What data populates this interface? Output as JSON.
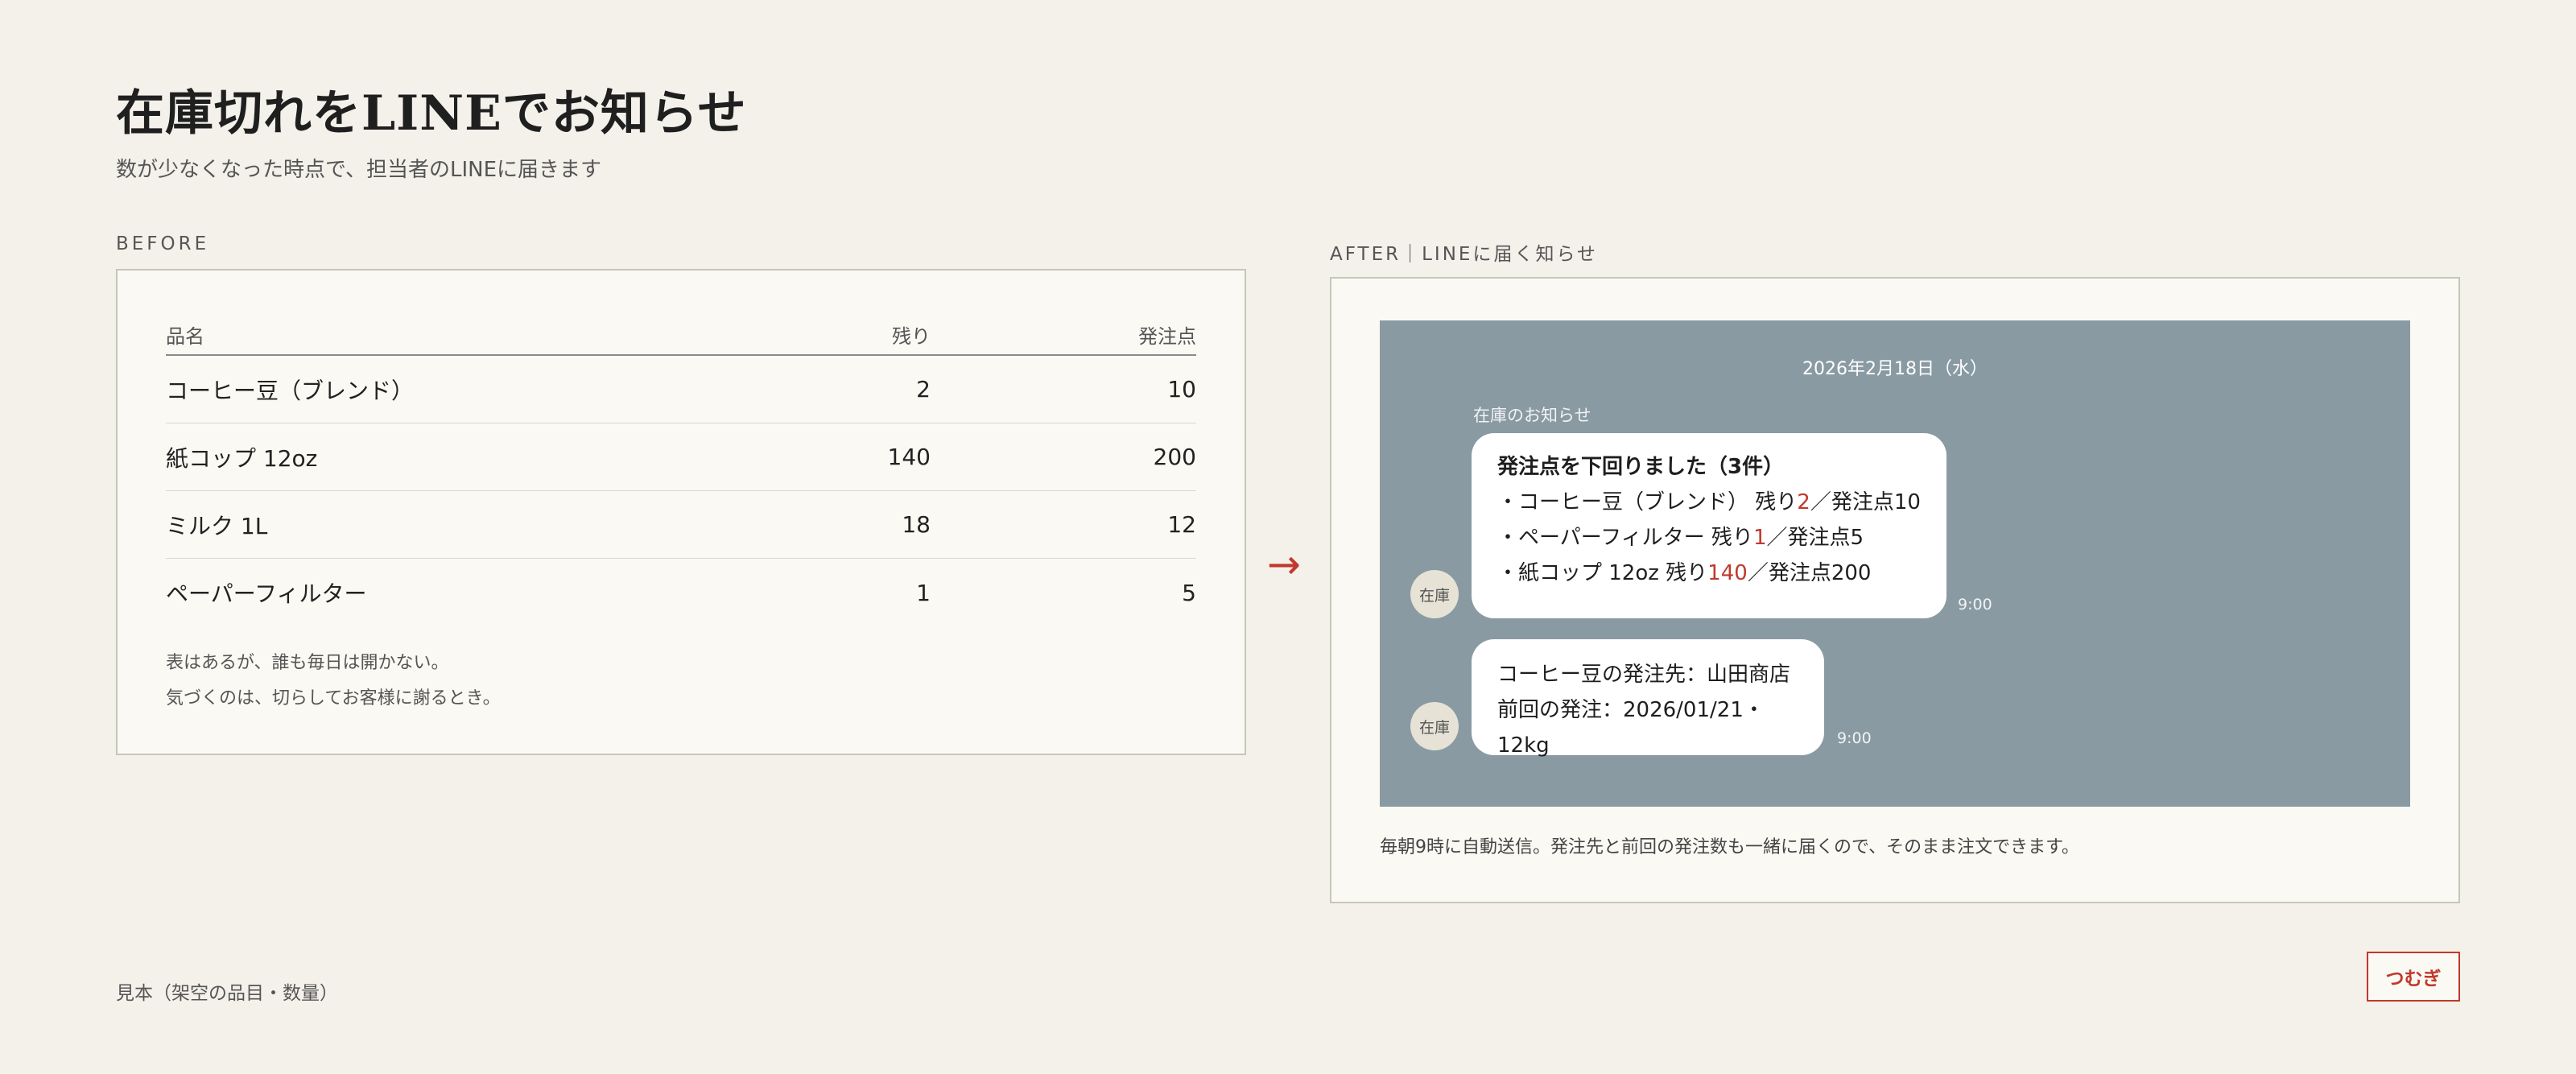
{
  "header": {
    "title": "在庫切れをLINEでお知らせ",
    "subtitle": "数が少なくなった時点で、担当者のLINEに届きます"
  },
  "before": {
    "label": "BEFORE",
    "columns": [
      "品名",
      "残り",
      "発注点"
    ],
    "rows": [
      {
        "name": "コーヒー豆（ブレンド）",
        "remaining": "2",
        "reorder_point": "10"
      },
      {
        "name": "紙コップ 12oz",
        "remaining": "140",
        "reorder_point": "200"
      },
      {
        "name": "ミルク 1L",
        "remaining": "18",
        "reorder_point": "12"
      },
      {
        "name": "ペーパーフィルター",
        "remaining": "1",
        "reorder_point": "5"
      }
    ],
    "note_line1": "表はあるが、誰も毎日は開かない。",
    "note_line2": "気づくのは、切らしてお客様に謝るとき。"
  },
  "arrow": "→",
  "after": {
    "label": "AFTER｜LINEに届く知らせ",
    "date": "2026年2月18日（水）",
    "sender": "在庫のお知らせ",
    "avatar_text": "在庫",
    "message1": {
      "title": "発注点を下回りました（3件）",
      "items": [
        {
          "prefix": "・コーヒー豆（ブレンド） 残り",
          "remaining": "2",
          "suffix": "／発注点10"
        },
        {
          "prefix": "・ペーパーフィルター 残り",
          "remaining": "1",
          "suffix": "／発注点5"
        },
        {
          "prefix": "・紙コップ 12oz 残り",
          "remaining": "140",
          "suffix": "／発注点200"
        }
      ],
      "time": "9:00"
    },
    "message2": {
      "line1": "コーヒー豆の発注先：山田商店",
      "line2": "前回の発注：2026/01/21・12kg",
      "time": "9:00"
    },
    "caption": "毎朝9時に自動送信。発注先と前回の発注数も一緒に届くので、そのまま注文できます。"
  },
  "footer": {
    "note": "見本（架空の品目・数量）",
    "brand": "つむぎ"
  },
  "colors": {
    "background": "#f3f1ea",
    "accent": "#c0392b",
    "chat_background": "#8a9aa3"
  }
}
